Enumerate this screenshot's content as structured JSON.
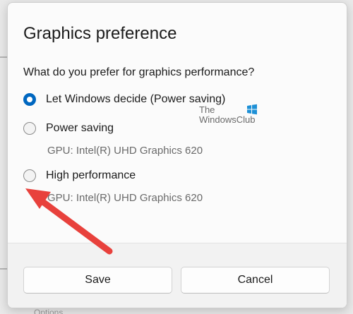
{
  "dialog": {
    "title": "Graphics preference",
    "question": "What do you prefer for graphics performance?",
    "options": [
      {
        "label": "Let Windows decide (Power saving)",
        "selected": true
      },
      {
        "label": "Power saving",
        "selected": false,
        "gpu": "GPU: Intel(R) UHD Graphics 620"
      },
      {
        "label": "High performance",
        "selected": false,
        "gpu": "GPU: Intel(R) UHD Graphics 620"
      }
    ],
    "save_label": "Save",
    "cancel_label": "Cancel"
  },
  "watermark": {
    "line1": "The",
    "line2": "WindowsClub"
  },
  "background": {
    "partial_text": "Options"
  },
  "colors": {
    "accent": "#0067c0",
    "arrow": "#e8413c"
  },
  "icons": {
    "annotation": "red-arrow-icon",
    "logo": "windowsclub-logo-icon"
  }
}
